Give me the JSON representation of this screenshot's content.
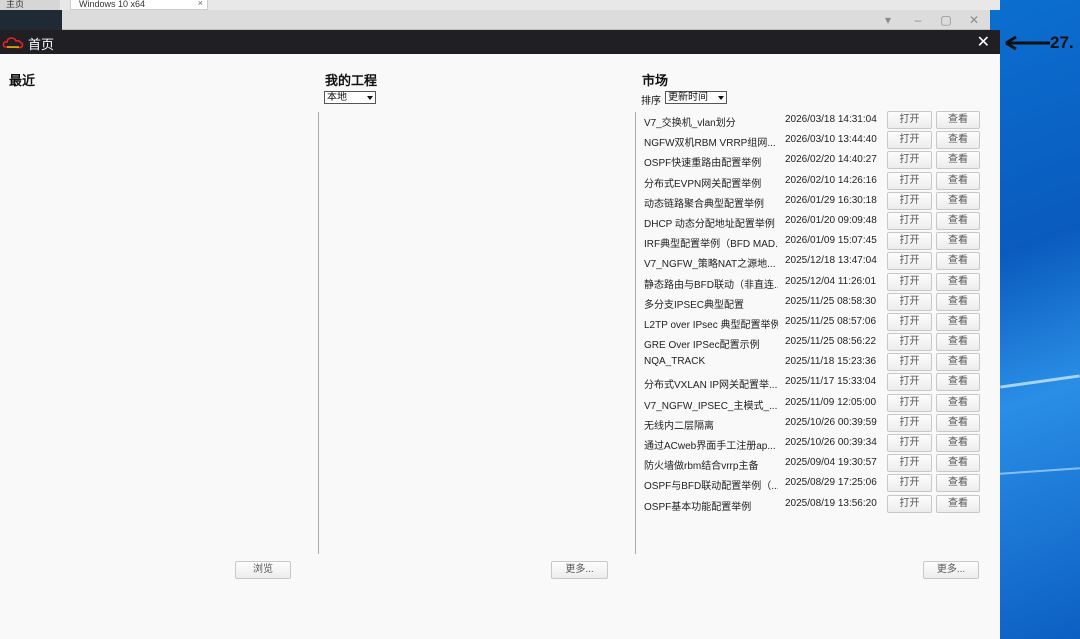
{
  "window": {
    "title": "首页",
    "close_label": "✕",
    "top_tab_left": "主页",
    "top_tab_right": "Windows 10 x64"
  },
  "annotation": {
    "text": "27."
  },
  "recent": {
    "title": "最近",
    "browse_label": "浏览"
  },
  "projects": {
    "title": "我的工程",
    "location_value": "本地",
    "more_label": "更多..."
  },
  "market": {
    "title": "市场",
    "sort_label": "排序",
    "sort_value": "更新时间",
    "more_label": "更多...",
    "open_label": "打开",
    "view_label": "查看",
    "items": [
      {
        "name": "V7_交换机_vlan划分",
        "date": "2026/03/18 14:31:04"
      },
      {
        "name": "NGFW双机RBM VRRP组网...",
        "date": "2026/03/10 13:44:40"
      },
      {
        "name": "OSPF快速重路由配置举例",
        "date": "2026/02/20 14:40:27"
      },
      {
        "name": "分布式EVPN网关配置举例",
        "date": "2026/02/10 14:26:16"
      },
      {
        "name": "动态链路聚合典型配置举例",
        "date": "2026/01/29 16:30:18"
      },
      {
        "name": "DHCP 动态分配地址配置举例",
        "date": "2026/01/20 09:09:48"
      },
      {
        "name": "IRF典型配置举例（BFD MAD...",
        "date": "2026/01/09 15:07:45"
      },
      {
        "name": "V7_NGFW_策略NAT之源地...",
        "date": "2025/12/18 13:47:04"
      },
      {
        "name": "静态路由与BFD联动（非直连...",
        "date": "2025/12/04 11:26:01"
      },
      {
        "name": "多分支IPSEC典型配置",
        "date": "2025/11/25 08:58:30"
      },
      {
        "name": "L2TP over IPsec 典型配置举例",
        "date": "2025/11/25 08:57:06"
      },
      {
        "name": "GRE Over IPSec配置示例",
        "date": "2025/11/25 08:56:22"
      },
      {
        "name": "NQA_TRACK",
        "date": "2025/11/18 15:23:36"
      },
      {
        "name": "分布式VXLAN IP网关配置举...",
        "date": "2025/11/17 15:33:04"
      },
      {
        "name": "V7_NGFW_IPSEC_主模式_...",
        "date": "2025/11/09 12:05:00"
      },
      {
        "name": "无线内二层隔离",
        "date": "2025/10/26 00:39:59"
      },
      {
        "name": "通过ACweb界面手工注册ap...",
        "date": "2025/10/26 00:39:34"
      },
      {
        "name": "防火墙做rbm结合vrrp主备",
        "date": "2025/09/04 19:30:57"
      },
      {
        "name": "OSPF与BFD联动配置举例（...",
        "date": "2025/08/29 17:25:06"
      },
      {
        "name": "OSPF基本功能配置举例",
        "date": "2025/08/19 13:56:20"
      }
    ]
  },
  "colors": {
    "titlebar": "#1f1f24",
    "content_bg": "#f9f9f9",
    "desktop": "#0b6fd0"
  }
}
